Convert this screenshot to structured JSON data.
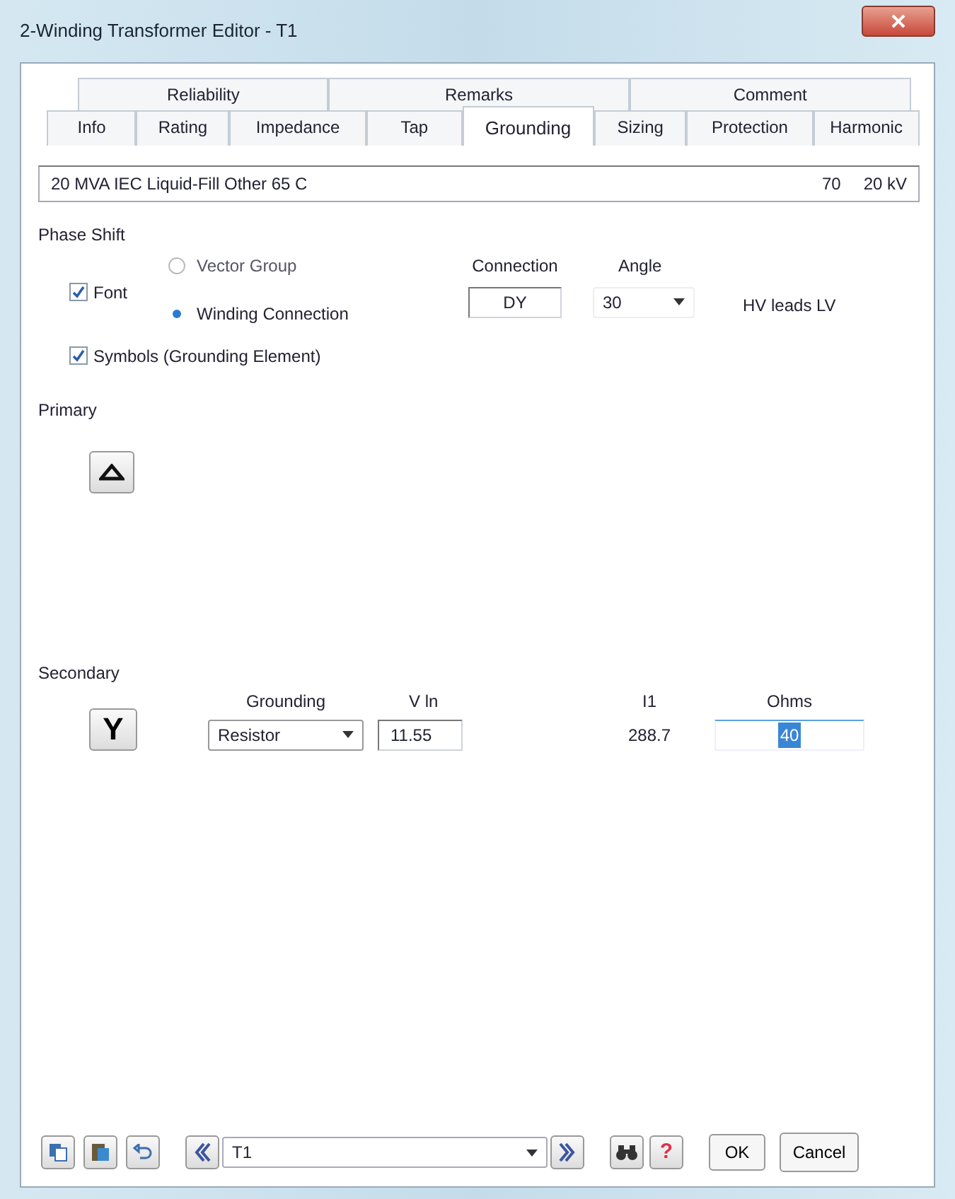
{
  "window": {
    "title": "2-Winding Transformer Editor - T1"
  },
  "tabs_top": [
    {
      "label": "Reliability",
      "selected": false
    },
    {
      "label": "Remarks",
      "selected": false
    },
    {
      "label": "Comment",
      "selected": false
    }
  ],
  "tabs": [
    {
      "label": "Info",
      "selected": false
    },
    {
      "label": "Rating",
      "selected": false
    },
    {
      "label": "Impedance",
      "selected": false
    },
    {
      "label": "Tap",
      "selected": false
    },
    {
      "label": "Grounding",
      "selected": true
    },
    {
      "label": "Sizing",
      "selected": false
    },
    {
      "label": "Protection",
      "selected": false
    },
    {
      "label": "Harmonic",
      "selected": false
    }
  ],
  "info_bar": {
    "summary": "20 MVA  IEC  Liquid-Fill  Other  65 C",
    "value": "70",
    "voltage": "20 kV"
  },
  "phase_shift": {
    "title": "Phase Shift",
    "font": {
      "label": "Font",
      "checked": true
    },
    "options": [
      {
        "label": "Vector Group",
        "selected": false,
        "disabled": true
      },
      {
        "label": "Winding Connection",
        "selected": true,
        "disabled": false
      }
    ],
    "connection": {
      "label": "Connection",
      "value": "DY"
    },
    "angle": {
      "label": "Angle",
      "value": "30"
    },
    "note": "HV leads LV",
    "symbols": {
      "label": "Symbols (Grounding Element)",
      "checked": true
    }
  },
  "primary": {
    "title": "Primary"
  },
  "secondary": {
    "title": "Secondary",
    "symbol": "Y",
    "columns": [
      "Grounding",
      "V ln",
      "I1",
      "Ohms"
    ],
    "grounding": "Resistor",
    "v_ln": "11.55",
    "i1": "288.7",
    "ohms": "40"
  },
  "footer": {
    "element": "T1",
    "help": "?",
    "ok": "OK",
    "cancel": "Cancel"
  }
}
